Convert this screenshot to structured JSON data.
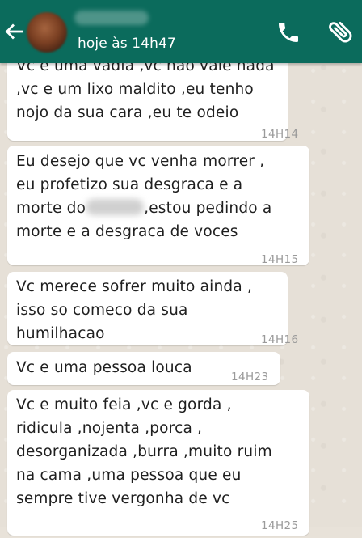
{
  "header": {
    "last_seen": "hoje às 14h47",
    "bg_color": "#0b6b5c"
  },
  "messages": [
    {
      "lines": [
        "Vc e uma vadia ,vc nao vale nada",
        ",vc e um lixo maldito ,eu tenho",
        "nojo da sua cara ,eu te odeio"
      ],
      "time": "14H14"
    },
    {
      "line1": "Eu desejo que vc venha morrer ,",
      "line2": "eu profetizo sua desgraca e a",
      "line3_before": "morte do",
      "line3_after": ",estou pedindo a",
      "line4": "morte e a desgraca de voces",
      "time": "14H15"
    },
    {
      "lines": [
        "Vc merece sofrer muito ainda ,",
        "isso so comeco da sua",
        "humilhacao"
      ],
      "time": "14H16"
    },
    {
      "lines": [
        "Vc e uma pessoa louca"
      ],
      "time": "14H23"
    },
    {
      "lines": [
        "Vc e muito feia ,vc e gorda ,",
        "ridicula ,nojenta ,porca ,",
        "desorganizada ,burra ,muito ruim",
        "na cama ,uma pessoa que eu",
        "sempre tive vergonha de vc"
      ],
      "time": "14H25"
    }
  ],
  "icons": {
    "back": "arrow-left",
    "call": "phone",
    "attach": "paperclip"
  }
}
